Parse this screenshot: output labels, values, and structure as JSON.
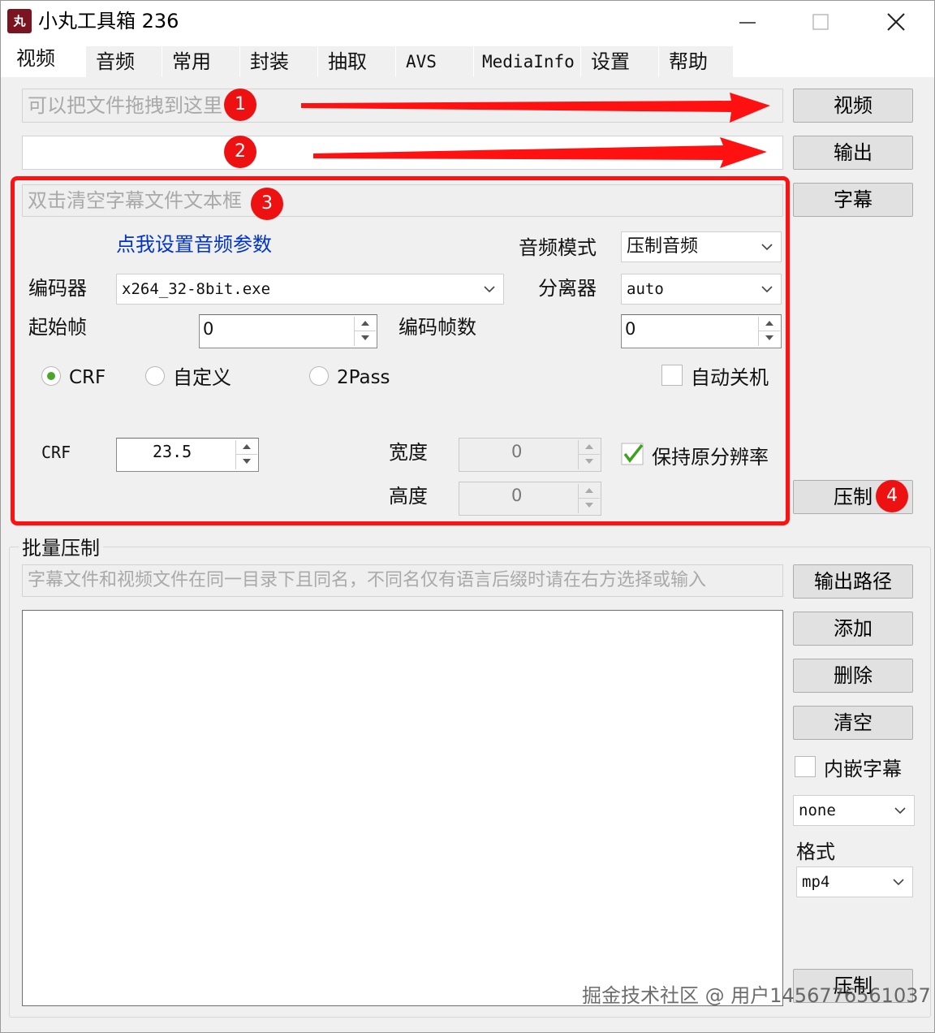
{
  "window": {
    "title": "小丸工具箱 236",
    "icon_text": "丸"
  },
  "tabs": [
    {
      "label": "视频",
      "active": true
    },
    {
      "label": "音频"
    },
    {
      "label": "常用"
    },
    {
      "label": "封装"
    },
    {
      "label": "抽取"
    },
    {
      "label": "AVS"
    },
    {
      "label": "MediaInfo"
    },
    {
      "label": "设置"
    },
    {
      "label": "帮助"
    }
  ],
  "inputs": {
    "video_placeholder": "可以把文件拖拽到这里",
    "output_value": "",
    "subtitle_placeholder": "双击清空字幕文件文本框"
  },
  "buttons": {
    "video": "视频",
    "output": "输出",
    "subtitle": "字幕",
    "encode": "压制",
    "output_path": "输出路径",
    "add": "添加",
    "delete": "删除",
    "clear": "清空",
    "batch_encode": "压制"
  },
  "annotations": {
    "badge1": "1",
    "badge2": "2",
    "badge3": "3",
    "badge4": "4",
    "accent": "#ff1111"
  },
  "settings": {
    "audio_link": "点我设置音频参数",
    "audio_mode_label": "音频模式",
    "audio_mode_value": "压制音频",
    "encoder_label": "编码器",
    "encoder_value": "x264_32-8bit.exe",
    "demuxer_label": "分离器",
    "demuxer_value": "auto",
    "start_frame_label": "起始帧",
    "start_frame_value": "0",
    "frame_count_label": "编码帧数",
    "frame_count_value": "0",
    "radio_crf": "CRF",
    "radio_custom": "自定义",
    "radio_2pass": "2Pass",
    "auto_shutdown_label": "自动关机",
    "crf_label": "CRF",
    "crf_value": "23.5",
    "width_label": "宽度",
    "width_value": "0",
    "height_label": "高度",
    "height_value": "0",
    "keep_resolution_label": "保持原分辨率"
  },
  "batch": {
    "group_label": "批量压制",
    "hint_placeholder": "字幕文件和视频文件在同一目录下且同名，不同名仅有语言后缀时请在右方选择或输入",
    "embed_subtitle_label": "内嵌字幕",
    "language_value": "none",
    "format_label": "格式",
    "format_value": "mp4"
  },
  "watermark": "掘金技术社区 @ 用户1456776561037"
}
